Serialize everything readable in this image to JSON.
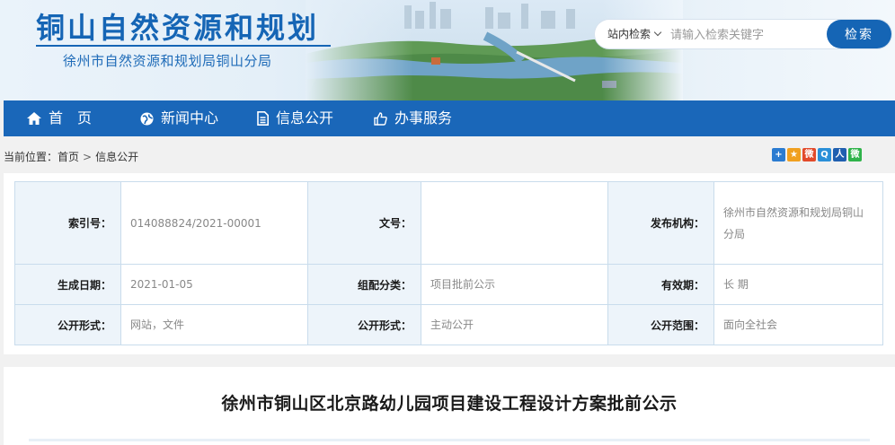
{
  "header": {
    "site_title": "铜山自然资源和规划",
    "site_subtitle": "徐州市自然资源和规划局铜山分局",
    "search": {
      "scope_label": "站内检索",
      "placeholder": "请输入检索关键字",
      "button_label": "检索"
    }
  },
  "nav": {
    "items": [
      {
        "label": "首　页",
        "icon": "home-icon"
      },
      {
        "label": "新闻中心",
        "icon": "globe-icon"
      },
      {
        "label": "信息公开",
        "icon": "document-icon"
      },
      {
        "label": "办事服务",
        "icon": "thumbs-up-icon"
      }
    ]
  },
  "breadcrumb": {
    "prefix": "当前位置：",
    "items": [
      "首页",
      "信息公开"
    ],
    "separator": ">"
  },
  "share": {
    "icons": [
      "add-share-icon",
      "star-share-icon",
      "weibo-icon",
      "qq-icon",
      "renren-icon",
      "wechat-icon"
    ],
    "glyphs": [
      "+",
      "★",
      "微",
      "Q",
      "人",
      "微"
    ],
    "colors": [
      "#2a7bd1",
      "#f0a020",
      "#e24a2a",
      "#2a8fd8",
      "#1f5fb0",
      "#2fb34a"
    ]
  },
  "meta": {
    "labels": {
      "index_no": "索引号：",
      "doc_no": "文号：",
      "publisher": "发布机构：",
      "gen_date": "生成日期：",
      "category": "组配分类：",
      "validity": "有效期：",
      "open_form": "公开形式：",
      "open_form2": "公开形式：",
      "open_scope": "公开范围："
    },
    "values": {
      "index_no": "014088824/2021-00001",
      "doc_no": "",
      "publisher": "徐州市自然资源和规划局铜山分局",
      "gen_date": "2021-01-05",
      "category": "项目批前公示",
      "validity": "长 期",
      "open_form": "网站，文件",
      "open_form2": "主动公开",
      "open_scope": "面向全社会"
    }
  },
  "article": {
    "title": "徐州市铜山区北京路幼儿园项目建设工程设计方案批前公示"
  },
  "colors": {
    "primary": "#1565b5",
    "nav_bg": "#1a67b9",
    "label_bg": "#edf4fa",
    "border": "#c9dcec"
  }
}
